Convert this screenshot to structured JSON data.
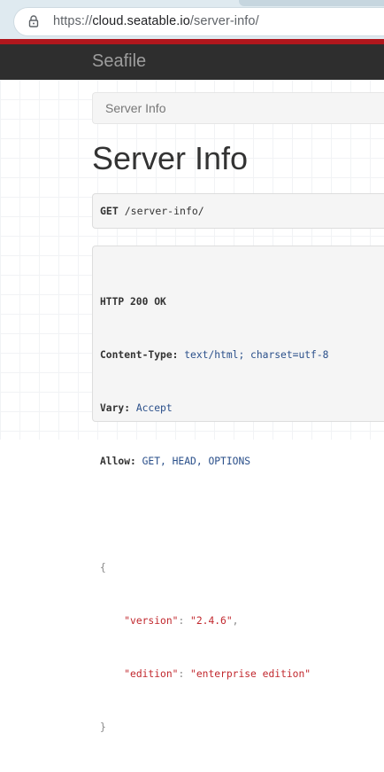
{
  "browser": {
    "url_prefix": "https://",
    "url_domain": "cloud.seatable.io",
    "url_path": "/server-info/"
  },
  "navbar": {
    "brand": "Seafile"
  },
  "breadcrumb": {
    "items": [
      "Server Info"
    ]
  },
  "page": {
    "title": "Server Info"
  },
  "request": {
    "method": "GET",
    "path": "/server-info/"
  },
  "response": {
    "status_line": "HTTP 200 OK",
    "headers": [
      {
        "name": "Content-Type:",
        "value": "text/html; charset=utf-8"
      },
      {
        "name": "Vary:",
        "value": "Accept"
      },
      {
        "name": "Allow:",
        "value": "GET, HEAD, OPTIONS"
      }
    ],
    "body": {
      "open_brace": "{",
      "close_brace": "}",
      "fields": [
        {
          "key": "\"version\"",
          "value": "\"2.4.6\"",
          "trail": ","
        },
        {
          "key": "\"edition\"",
          "value": "\"enterprise edition\"",
          "trail": ""
        }
      ]
    }
  },
  "colors": {
    "navbar_bg": "#2e2e2e",
    "accent_stripe": "#b0171d",
    "string_value": "#c1272d",
    "header_value": "#2a4f8a"
  }
}
